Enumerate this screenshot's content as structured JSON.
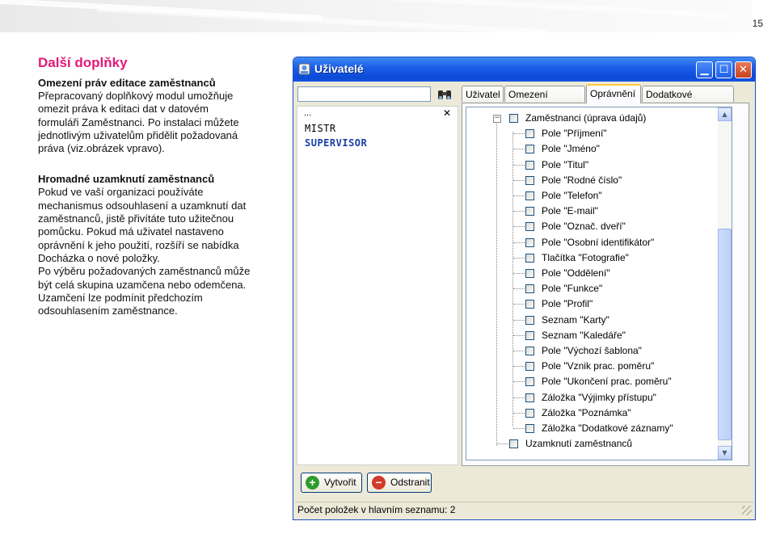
{
  "page": {
    "number": "15"
  },
  "article": {
    "section_title": "Další doplňky",
    "block1": {
      "heading": "Omezení práv editace zaměstnanců",
      "lines": [
        "Přepracovaný doplňkový modul umožňuje",
        "omezit práva k editaci dat v datovém",
        "formuláři Zaměstnanci. Po instalaci můžete",
        "jednotlivým uživatelům přidělit požadovaná",
        "práva (viz.obrázek vpravo)."
      ]
    },
    "block2": {
      "heading": "Hromadné uzamknutí zaměstnanců",
      "lines": [
        "Pokud ve vaší organizaci používáte",
        "mechanismus odsouhlasení a uzamknutí dat",
        "zaměstnanců, jistě přivítáte tuto užitečnou",
        "pomůcku. Pokud má uživatel nastaveno",
        "oprávnění k jeho použití, rozšíří se nabídka",
        "Docházka o nové položky.",
        "Po výběru požadovaných zaměstnanců může",
        "být celá skupina uzamčena nebo odemčena.",
        "Uzamčení lze podmínit předchozím",
        "odsouhlasením zaměstnance."
      ]
    }
  },
  "window": {
    "title": "Uživatelé",
    "search_value": "",
    "list": {
      "header": "...",
      "items": [
        "MISTR",
        "SUPERVISOR"
      ],
      "selected": "SUPERVISOR"
    },
    "tabs": [
      "Uživatel",
      "Omezení přístupu",
      "Oprávnění",
      "Dodatkové záznamy"
    ],
    "active_tab": "Oprávnění",
    "tree": {
      "root": "Zaměstnanci (úprava údajů)",
      "children": [
        "Pole \"Příjmení\"",
        "Pole \"Jméno\"",
        "Pole \"Titul\"",
        "Pole \"Rodné číslo\"",
        "Pole \"Telefon\"",
        "Pole \"E-mail\"",
        "Pole \"Označ. dveří\"",
        "Pole \"Osobní identifikátor\"",
        "Tlačítka \"Fotografie\"",
        "Pole \"Oddělení\"",
        "Pole \"Funkce\"",
        "Pole \"Profil\"",
        "Seznam \"Karty\"",
        "Seznam \"Kaledáře\"",
        "Pole \"Výchozí šablona\"",
        "Pole \"Vznik prac. poměru\"",
        "Pole \"Ukončení prac. poměru\"",
        "Záložka \"Výjimky přístupu\"",
        "Záložka \"Poznámka\"",
        "Záložka \"Dodatkové záznamy\""
      ],
      "sibling": "Uzamknutí zaměstnanců"
    },
    "buttons": {
      "create": "Vytvořit",
      "delete": "Odstranit"
    },
    "status": "Počet položek v hlavním seznamu: 2",
    "colors": {
      "accent_title": "#e2197a",
      "titlebar": "#0a4ad8",
      "selected_item": "#1a3ea8"
    }
  }
}
